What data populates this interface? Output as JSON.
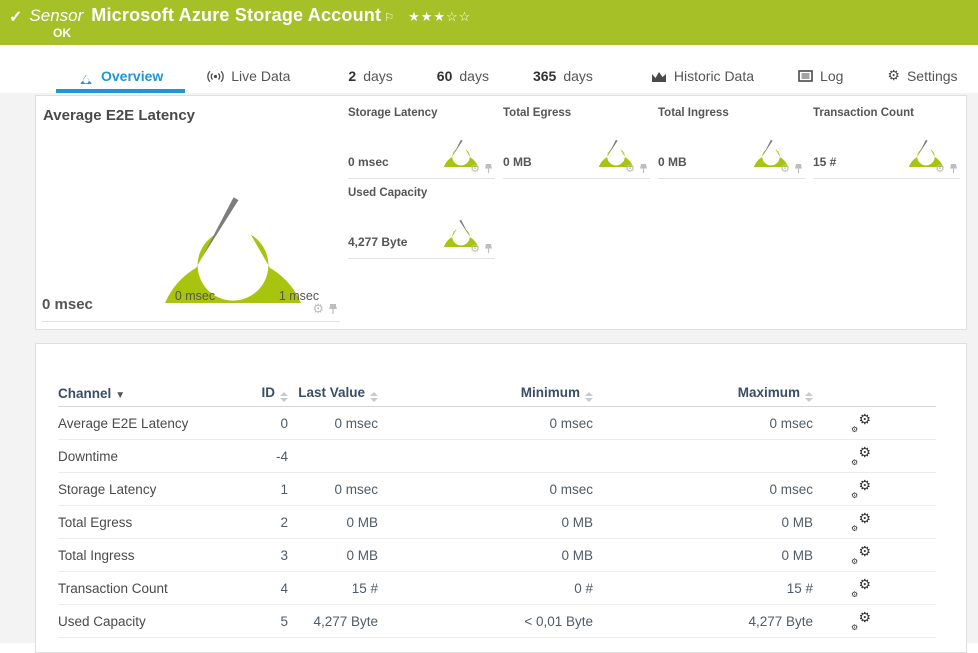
{
  "colors": {
    "banner_green": "#a6c028",
    "gauge_green": "#a9c40f",
    "accent_blue": "#1e96d2",
    "needle_gray": "#7d7d7d"
  },
  "banner": {
    "status_icon": "✓",
    "kind": "Sensor",
    "title": "Microsoft Azure Storage Account",
    "flag_icon": "⚐",
    "stars_filled": "★★★",
    "stars_empty": "☆☆",
    "status": "OK"
  },
  "tabs": [
    {
      "label": "Overview"
    },
    {
      "label": "Live Data"
    },
    {
      "number": "2",
      "label": "days"
    },
    {
      "number": "60",
      "label": "days"
    },
    {
      "number": "365",
      "label": "days"
    },
    {
      "label": "Historic Data"
    },
    {
      "label": "Log"
    },
    {
      "label": "Settings"
    }
  ],
  "main_gauge": {
    "title": "Average E2E Latency",
    "value": "0 msec",
    "scale_min": "0 msec",
    "scale_max": "1 msec"
  },
  "mini_gauges": [
    {
      "title": "Storage Latency",
      "value": "0 msec"
    },
    {
      "title": "Total Egress",
      "value": "0 MB"
    },
    {
      "title": "Total Ingress",
      "value": "0 MB"
    },
    {
      "title": "Transaction Count",
      "value": "15 #"
    },
    {
      "title": "Used Capacity",
      "value": "4,277 Byte"
    }
  ],
  "table": {
    "headers": {
      "channel": "Channel",
      "id": "ID",
      "last_value": "Last Value",
      "minimum": "Minimum",
      "maximum": "Maximum"
    },
    "rows": [
      {
        "channel": "Average E2E Latency",
        "id": "0",
        "last": "0 msec",
        "min": "0 msec",
        "max": "0 msec"
      },
      {
        "channel": "Downtime",
        "id": "-4",
        "last": "",
        "min": "",
        "max": ""
      },
      {
        "channel": "Storage Latency",
        "id": "1",
        "last": "0 msec",
        "min": "0 msec",
        "max": "0 msec"
      },
      {
        "channel": "Total Egress",
        "id": "2",
        "last": "0 MB",
        "min": "0 MB",
        "max": "0 MB"
      },
      {
        "channel": "Total Ingress",
        "id": "3",
        "last": "0 MB",
        "min": "0 MB",
        "max": "0 MB"
      },
      {
        "channel": "Transaction Count",
        "id": "4",
        "last": "15 #",
        "min": "0 #",
        "max": "15 #"
      },
      {
        "channel": "Used Capacity",
        "id": "5",
        "last": "4,277 Byte",
        "min": "< 0,01 Byte",
        "max": "4,277 Byte"
      }
    ]
  }
}
